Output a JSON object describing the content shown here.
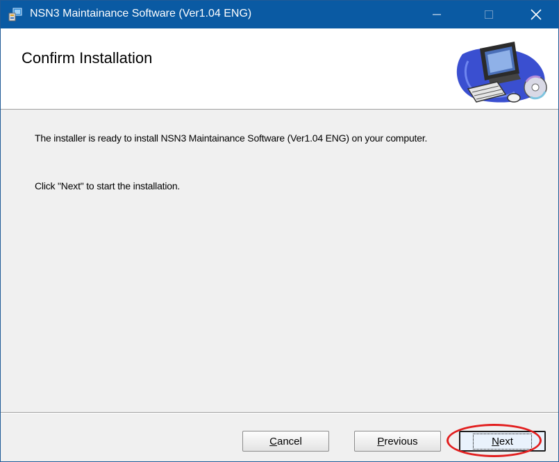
{
  "window": {
    "title": "NSN3 Maintainance Software (Ver1.04 ENG)",
    "icon": "installer-icon",
    "controls": [
      "minimize-icon",
      "maximize-icon",
      "close-icon"
    ]
  },
  "banner": {
    "heading": "Confirm Installation",
    "art": "computer-cd-illustration"
  },
  "content": {
    "message_line1": "The installer is ready to install NSN3 Maintainance Software (Ver1.04 ENG) on your computer.",
    "message_line2": "Click \"Next\" to start the installation."
  },
  "buttons": {
    "cancel": {
      "access_key": "C",
      "rest": "ancel"
    },
    "previous": {
      "access_key": "P",
      "rest": "revious"
    },
    "next": {
      "access_key": "N",
      "rest": "ext"
    }
  },
  "colors": {
    "titlebar": "#0a5aa3",
    "highlight_circle": "#e21e1e",
    "dialog_bg": "#f0f0f0"
  }
}
